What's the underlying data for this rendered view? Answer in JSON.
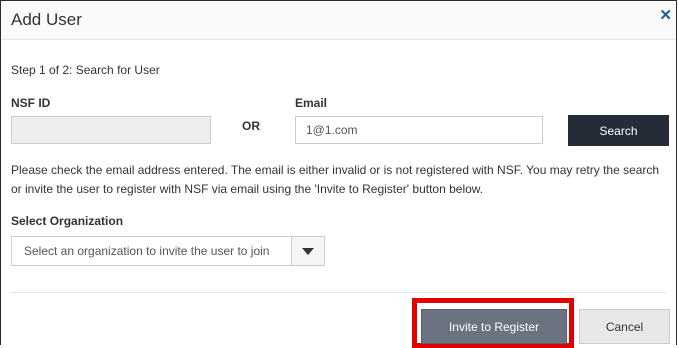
{
  "dialog": {
    "title": "Add User",
    "close_icon": "close-icon"
  },
  "step": {
    "text": "Step 1 of 2: Search for User"
  },
  "nsf_id": {
    "label": "NSF ID",
    "value": "",
    "placeholder": ""
  },
  "or_text": "OR",
  "email": {
    "label": "Email",
    "value": "1@1.com"
  },
  "search_button": {
    "label": "Search"
  },
  "message": "Please check the email address entered. The email is either invalid or is not registered with NSF. You may retry the search or invite the user to register with NSF via email using the 'Invite to Register' button below.",
  "organization": {
    "label": "Select Organization",
    "selected": "Select an organization to invite the user to join",
    "arrow_icon": "chevron-down-icon"
  },
  "footer": {
    "invite_label": "Invite to Register",
    "cancel_label": "Cancel"
  },
  "colors": {
    "search_button_bg": "#252c37",
    "invite_button_bg": "#6b7280",
    "highlight_border": "#e00000",
    "close_icon": "#1f5f8b"
  }
}
